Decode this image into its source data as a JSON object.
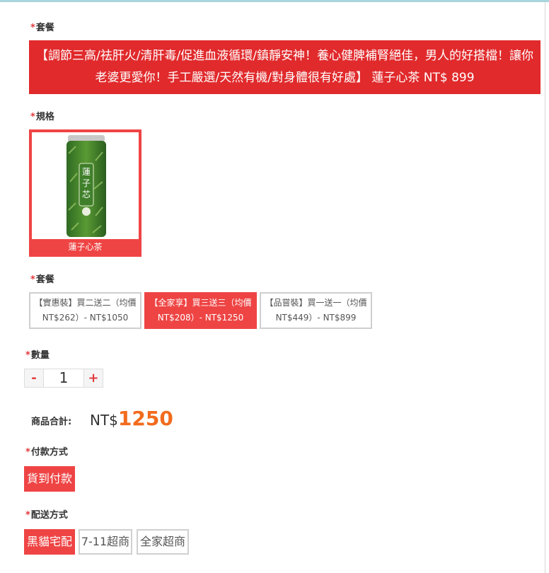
{
  "sections": {
    "package_top_label": "套餐",
    "spec_label": "規格",
    "package_label": "套餐",
    "quantity_label": "數量",
    "payment_label": "付款方式",
    "shipping_label": "配送方式",
    "required_mark": "*"
  },
  "banner": {
    "line1": "【調節三高/祛肝火/清肝毒/促進血液循環/鎮靜安神！養心健脾補腎絕佳，男人的好搭檔！讓你",
    "line2": "老婆更愛你！手工嚴選/天然有機/對身體很有好處】 蓮子心茶 NT$ 899"
  },
  "spec": {
    "caption": "蓮子心茶",
    "jar_text": [
      "蓮",
      "子",
      "芯"
    ]
  },
  "packages": [
    {
      "line1": "【實惠裝】買二送二（均價",
      "line2": "NT$262）- NT$1050",
      "active": false
    },
    {
      "line1": "【全家享】買三送三（均價",
      "line2": "NT$208）- NT$1250",
      "active": true
    },
    {
      "line1": "【品嘗裝】買一送一（均價",
      "line2": "NT$449）- NT$899",
      "active": false
    }
  ],
  "quantity": {
    "minus": "-",
    "value": "1",
    "plus": "+"
  },
  "total": {
    "label": "商品合計:",
    "currency": "NT$",
    "amount": "1250"
  },
  "payment": {
    "options": [
      "貨到付款"
    ]
  },
  "shipping": {
    "options": [
      "黑貓宅配",
      "7-11超商",
      "全家超商"
    ]
  },
  "colors": {
    "accent": "#ef4444",
    "banner": "#e12a2c",
    "price": "#f26b1d"
  }
}
